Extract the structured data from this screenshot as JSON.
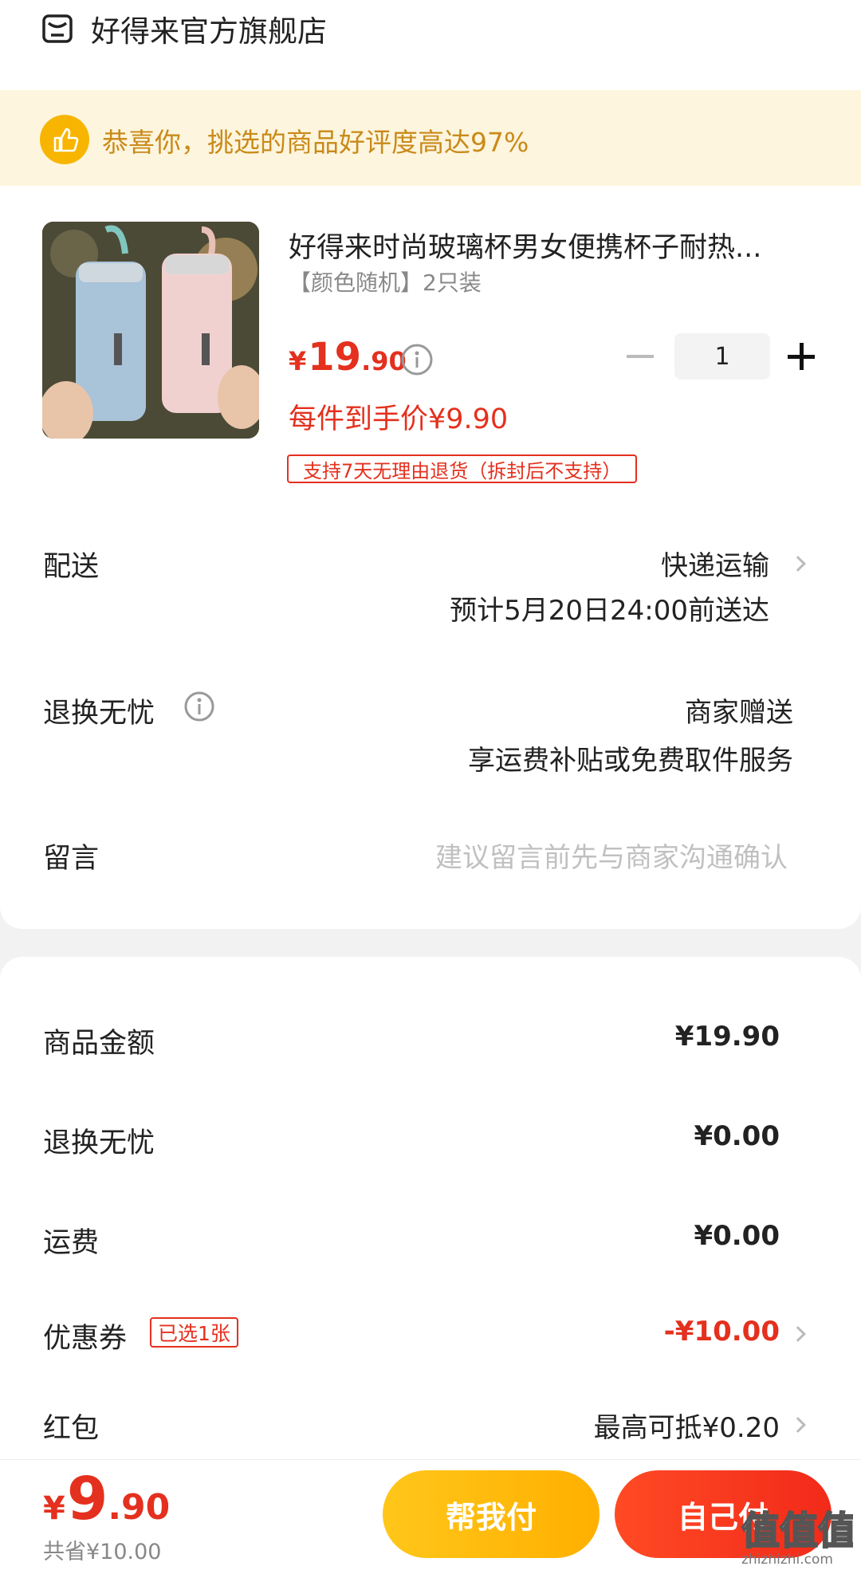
{
  "store": {
    "name": "好得来官方旗舰店",
    "icon": "store-icon"
  },
  "banner": {
    "text": "恭喜你，挑选的商品好评度高达97%",
    "icon": "thumbs-up-icon"
  },
  "product": {
    "title": "好得来时尚玻璃杯男女便携杯子耐热...",
    "spec": "【颜色随机】2只装",
    "price_currency": "¥",
    "price_int": "19",
    "price_dec": ".90",
    "quantity": "1",
    "unit_price": "每件到手价¥9.90",
    "return_policy": "支持7天无理由退货（拆封后不支持）"
  },
  "delivery": {
    "label": "配送",
    "method": "快递运输",
    "eta": "预计5月20日24:00前送达"
  },
  "return_service": {
    "label": "退换无忧",
    "line1": "商家赠送",
    "line2": "享运费补贴或免费取件服务"
  },
  "message": {
    "label": "留言",
    "placeholder": "建议留言前先与商家沟通确认"
  },
  "summary": {
    "goods_label": "商品金额",
    "goods_value": "¥19.90",
    "return_label": "退换无忧",
    "return_value": "¥0.00",
    "shipping_label": "运费",
    "shipping_value": "¥0.00",
    "coupon_label": "优惠券",
    "coupon_tag": "已选1张",
    "coupon_value": "-¥10.00",
    "redpack_label": "红包",
    "redpack_value": "最高可抵¥0.20"
  },
  "footer": {
    "total_currency": "¥",
    "total_int": "9",
    "total_dec": ".90",
    "saved": "共省¥10.00",
    "help_pay": "帮我付",
    "self_pay": "自己付",
    "watermark": "zhizhizhi.com"
  },
  "colors": {
    "accent_red": "#e4301e",
    "banner_bg": "#fdf5dd",
    "banner_text": "#c98a1a",
    "help_btn": "#ffc61a"
  }
}
